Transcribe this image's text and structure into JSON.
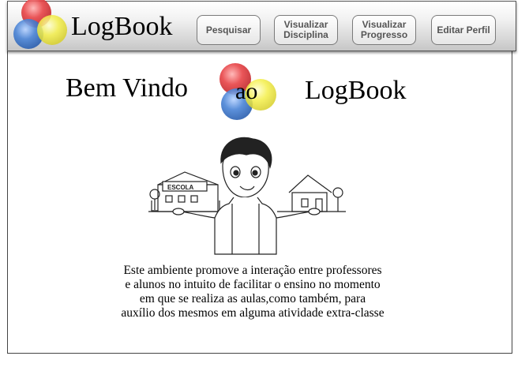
{
  "header": {
    "logo_text": "LogBook",
    "nav": [
      {
        "label": "Pesquisar"
      },
      {
        "label": "Visualizar\nDisciplina"
      },
      {
        "label": "Visualizar\nProgresso"
      },
      {
        "label": "Editar Perfil"
      }
    ]
  },
  "welcome": {
    "part1": "Bem Vindo",
    "part2": "ao",
    "part3": "LogBook"
  },
  "illustration": {
    "sign_text": "ESCOLA"
  },
  "description": {
    "lines": [
      "Este ambiente promove a interação entre professores",
      "e alunos no intuito de facilitar o ensino no momento",
      "em que se realiza as aulas,como também, para",
      "auxílio dos mesmos em alguma atividade extra-classe"
    ]
  },
  "colors": {
    "circle_red": "#e8474a",
    "circle_blue": "#4a84d6",
    "circle_yellow": "#f4ef4a"
  }
}
